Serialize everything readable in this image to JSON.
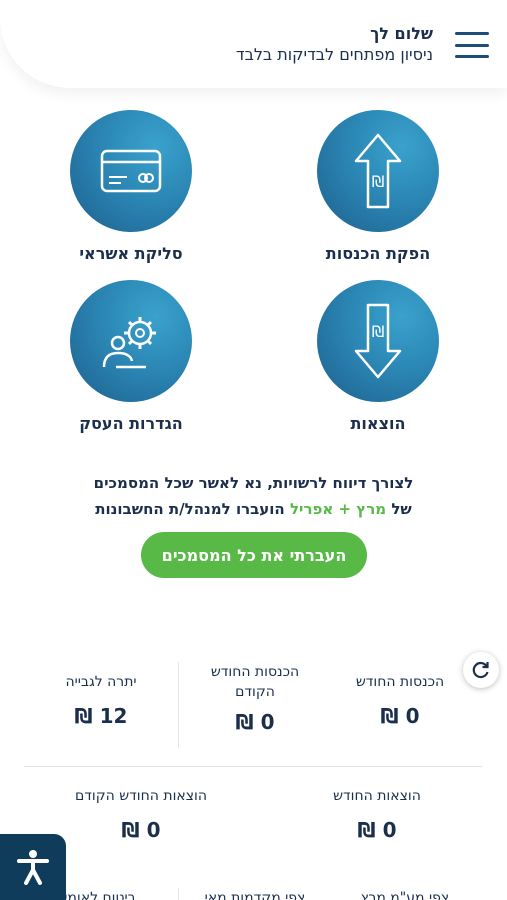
{
  "header": {
    "greeting": "שלום לך",
    "subtitle": "ניסיון מפתחים לבדיקות בלבד"
  },
  "tiles": {
    "issue_income": "הפקת הכנסות",
    "credit_clearing": "סליקת אשראי",
    "expenses": "הוצאות",
    "business_settings": "הגדרות העסק"
  },
  "notice": {
    "line1": "לצורך דיווח לרשויות, נא לאשר שכל המסמכים",
    "line2_prefix": "של",
    "line2_months": "מרץ + אפריל",
    "line2_suffix": "הועברו למנהל/ת החשבונות"
  },
  "cta": {
    "label": "העברתי את כל המסמכים"
  },
  "stats": {
    "income_month_label": "הכנסות החודש",
    "income_month_value": "0 ₪",
    "income_prev_label": "הכנסות החודש הקודם",
    "income_prev_value": "0 ₪",
    "balance_label": "יתרה לגבייה",
    "balance_value": "12 ₪",
    "expenses_month_label": "הוצאות החודש",
    "expenses_month_value": "0 ₪",
    "expenses_prev_label": "הוצאות החודש הקודם",
    "expenses_prev_value": "0 ₪"
  },
  "bottom_cut": {
    "c1": "צפי מע\"מ מרץ",
    "c2": "צפי מקדמות מאי",
    "c3": "ביטוח לאומי"
  },
  "colors": {
    "primary": "#1b4e7a",
    "accent_green": "#58b947",
    "circle_start": "#3aa2cc",
    "circle_end": "#1d5f8d"
  },
  "icons": [
    "menu-icon",
    "arrow-up-shekel-icon",
    "credit-card-icon",
    "arrow-down-shekel-icon",
    "user-gear-icon",
    "refresh-icon",
    "accessibility-icon"
  ]
}
